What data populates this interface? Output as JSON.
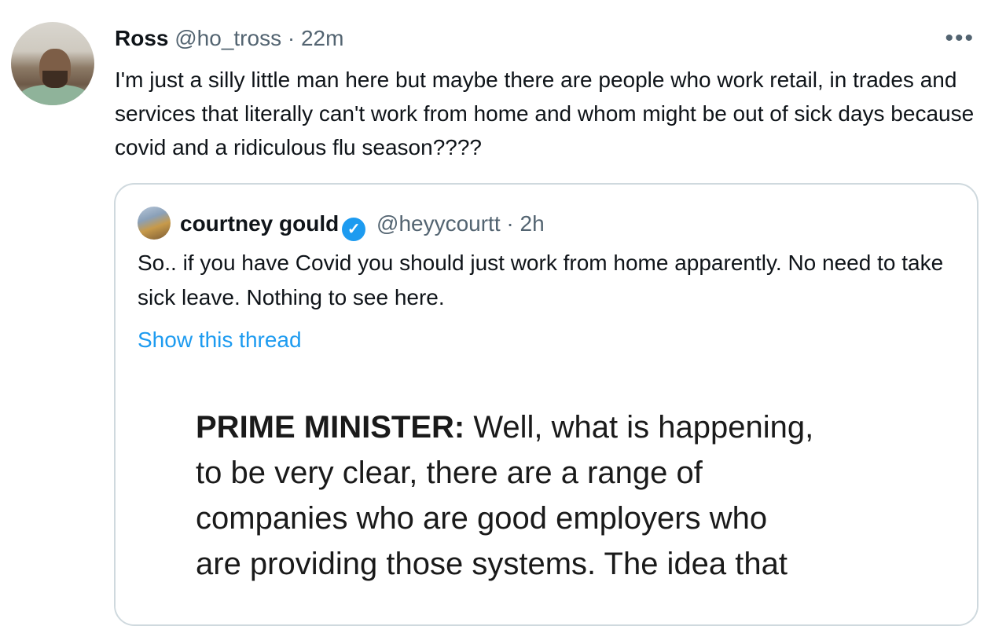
{
  "tweet": {
    "author_name": "Ross",
    "handle": "@ho_tross",
    "separator": "·",
    "time": "22m",
    "more_icon": "more-horizontal-icon",
    "text": "I'm just a silly little man here but maybe there are people who work retail, in trades and services that literally can't work from home and whom might be out of sick days because covid and a ridiculous flu season????"
  },
  "quote": {
    "author_name": "courtney gould",
    "verified_icon": "verified-badge-icon",
    "verified_glyph": "✓",
    "handle": "@heyycourtt",
    "separator": "·",
    "time": "2h",
    "text": "So.. if you have Covid you should just work from home apparently. No need to take sick leave. Nothing to see here.",
    "show_thread": "Show this thread",
    "media": {
      "speaker": "PRIME MINISTER:",
      "lines": [
        "Well, what is happening,",
        "to be very clear, there are a range of",
        "companies who are good employers who",
        "are providing those systems. The idea that"
      ]
    }
  },
  "colors": {
    "text": "#0f1419",
    "muted": "#536471",
    "link": "#1d9bf0",
    "border": "#cfd9de"
  }
}
